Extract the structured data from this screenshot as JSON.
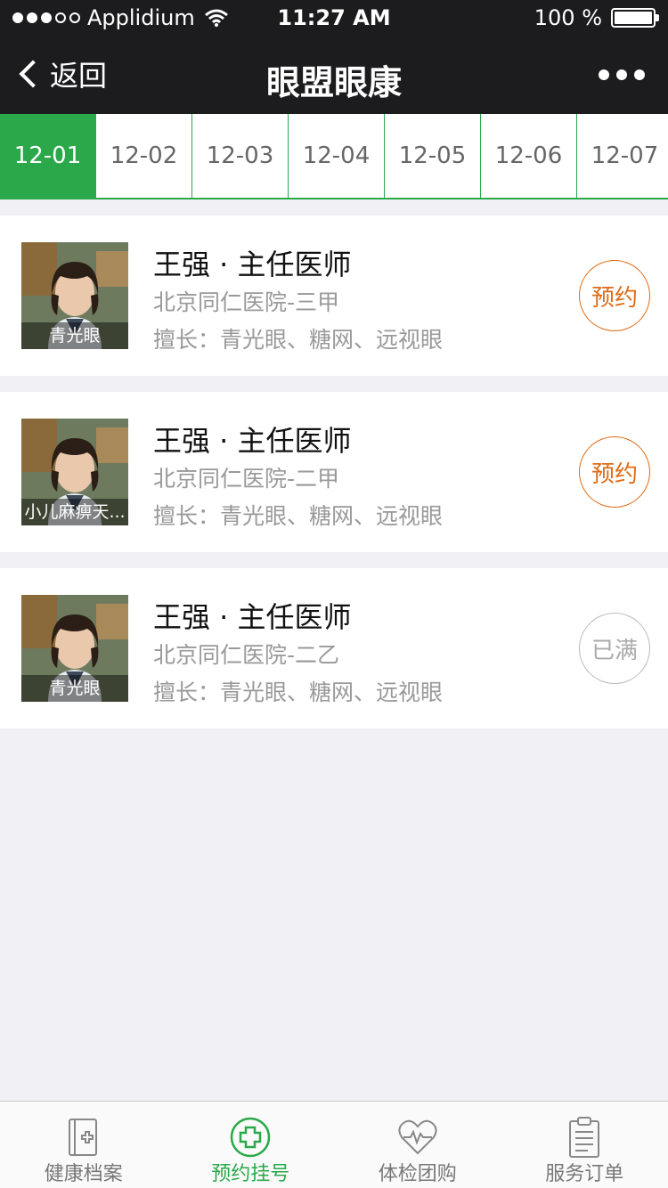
{
  "status_bar": {
    "carrier": "Applidium",
    "time": "11:27 AM",
    "battery": "100 %",
    "signal_bars_filled": 3,
    "signal_bars_total": 5
  },
  "nav": {
    "back_label": "返回",
    "title": "眼盟眼康"
  },
  "date_tabs": [
    {
      "label": "12-01",
      "active": true
    },
    {
      "label": "12-02",
      "active": false
    },
    {
      "label": "12-03",
      "active": false
    },
    {
      "label": "12-04",
      "active": false
    },
    {
      "label": "12-05",
      "active": false
    },
    {
      "label": "12-06",
      "active": false
    },
    {
      "label": "12-07",
      "active": false
    }
  ],
  "doctors": [
    {
      "tag": "青光眼",
      "name": "王强 · 主任医师",
      "hospital": "北京同仁医院-三甲",
      "specialty": "擅长：青光眼、糖网、远视眼",
      "action": "预约",
      "full": false
    },
    {
      "tag": "小儿麻痹天...",
      "name": "王强 · 主任医师",
      "hospital": "北京同仁医院-二甲",
      "specialty": "擅长：青光眼、糖网、远视眼",
      "action": "预约",
      "full": false
    },
    {
      "tag": "青光眼",
      "name": "王强 · 主任医师",
      "hospital": "北京同仁医院-二乙",
      "specialty": "擅长：青光眼、糖网、远视眼",
      "action": "已满",
      "full": true
    }
  ],
  "tab_bar": [
    {
      "label": "健康档案",
      "icon": "medical-record-icon",
      "active": false
    },
    {
      "label": "预约挂号",
      "icon": "plus-circle-icon",
      "active": true
    },
    {
      "label": "体检团购",
      "icon": "heart-pulse-icon",
      "active": false
    },
    {
      "label": "服务订单",
      "icon": "clipboard-icon",
      "active": false
    }
  ],
  "colors": {
    "accent_green": "#2aa84a",
    "book_orange": "#e06b14",
    "nav_bg": "#1c1c1e"
  }
}
